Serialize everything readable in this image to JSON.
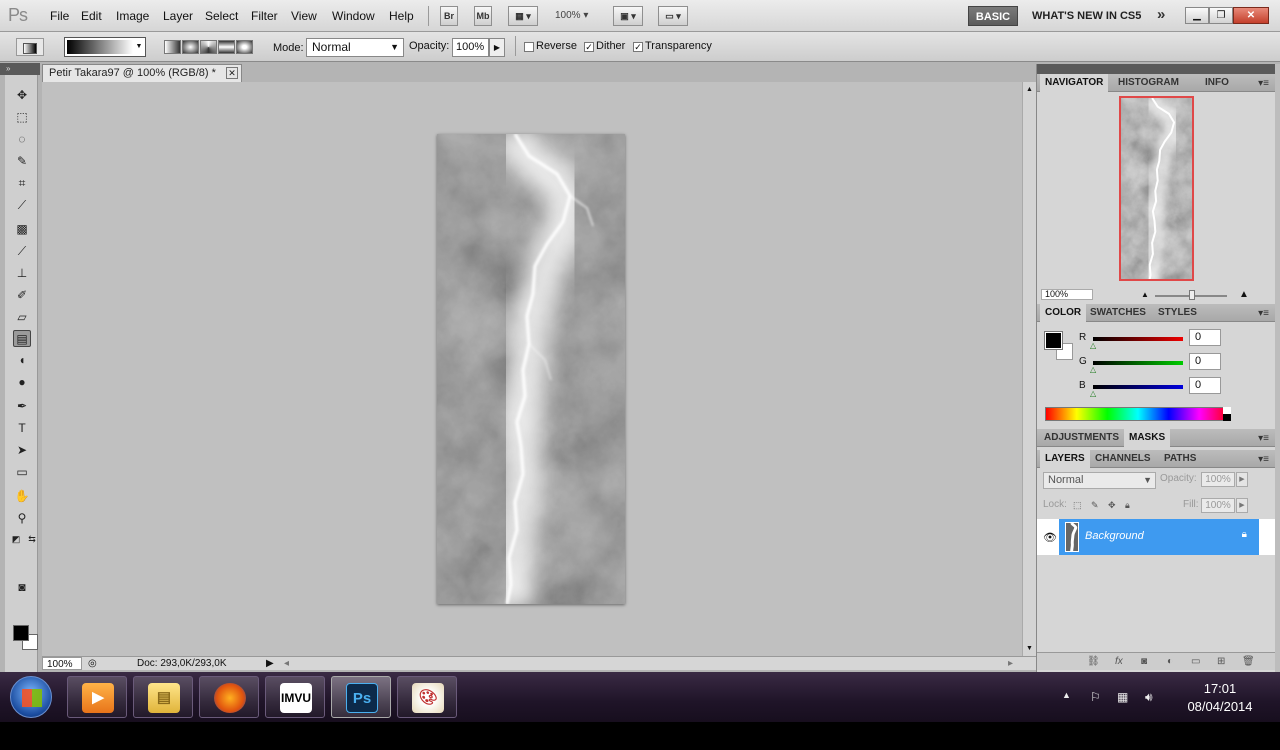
{
  "app": {
    "logo": "Ps",
    "menus": [
      "File",
      "Edit",
      "Image",
      "Layer",
      "Select",
      "Filter",
      "View",
      "Window",
      "Help"
    ],
    "bridge_label": "Br",
    "minibridge_label": "Mb",
    "zoom_menu": "100%",
    "workspace_button": "BASIC",
    "whats_new": "WHAT'S NEW IN CS5",
    "more_workspaces": "»"
  },
  "options": {
    "mode_label": "Mode:",
    "mode_value": "Normal",
    "opacity_label": "Opacity:",
    "opacity_value": "100%",
    "reverse_label": "Reverse",
    "reverse_checked": false,
    "dither_label": "Dither",
    "dither_checked": true,
    "transparency_label": "Transparency",
    "transparency_checked": true
  },
  "document": {
    "tab_title": "Petir Takara97 @ 100% (RGB/8) *",
    "zoom": "100%",
    "doc_info": "Doc: 293,0K/293,0K"
  },
  "panels": {
    "navigator_tabs": [
      "NAVIGATOR",
      "HISTOGRAM",
      "INFO"
    ],
    "navigator_zoom": "100%",
    "color_tabs": [
      "COLOR",
      "SWATCHES",
      "STYLES"
    ],
    "color": {
      "r_label": "R",
      "r_value": "0",
      "r_color": "#cc0000",
      "g_label": "G",
      "g_value": "0",
      "g_color": "#009900",
      "b_label": "B",
      "b_value": "0",
      "b_color": "#0000cc"
    },
    "adjust_tabs": [
      "ADJUSTMENTS",
      "MASKS"
    ],
    "layers_tabs": [
      "LAYERS",
      "CHANNELS",
      "PATHS"
    ],
    "layers": {
      "blend_mode": "Normal",
      "opacity_label": "Opacity:",
      "opacity_value": "100%",
      "lock_label": "Lock:",
      "fill_label": "Fill:",
      "fill_value": "100%",
      "items": [
        {
          "name": "Background"
        }
      ]
    }
  },
  "taskbar": {
    "time": "17:01",
    "date": "08/04/2014",
    "apps": [
      "media-player",
      "file-explorer",
      "firefox",
      "imvu",
      "photoshop",
      "paint"
    ],
    "active_app": "photoshop"
  }
}
